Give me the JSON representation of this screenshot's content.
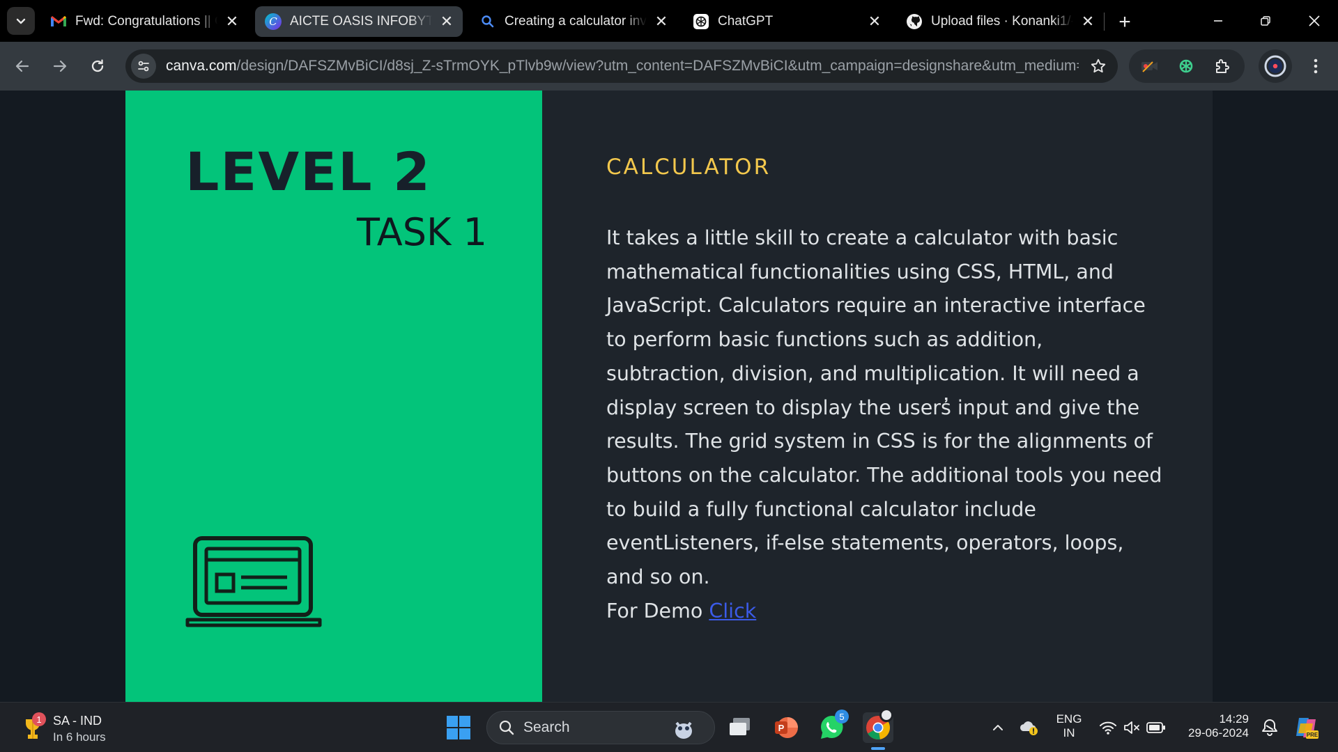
{
  "browser": {
    "tabs": [
      {
        "title": "Fwd: Congratulations || O",
        "favicon": "gmail-icon"
      },
      {
        "title": "AICTE OASIS INFOBYTE S",
        "favicon": "canva-icon",
        "active": true
      },
      {
        "title": "Creating a calculator invo",
        "favicon": "search-icon"
      },
      {
        "title": "ChatGPT",
        "favicon": "chatgpt-icon"
      },
      {
        "title": "Upload files · Konanki1/-",
        "favicon": "github-icon"
      }
    ],
    "url_host": "canva.com",
    "url_path": "/design/DAFSZMvBiCI/d8sj_Z-sTrmOYK_pTlvb9w/view?utm_content=DAFSZMvBiCI&utm_campaign=designshare&utm_medium=..."
  },
  "slide": {
    "level": "LEVEL 2",
    "task": "TASK 1",
    "heading": "CALCULATOR",
    "description": "It takes a little skill to create a calculator with basic mathematical functionalities using CSS, HTML, and JavaScript. Calculators require an interactive interface to perform basic functions such as addition, subtraction, division, and multiplication. It will need a  display screen to display the users̓ input and give the results. The grid system in CSS is for the alignments of buttons on the calculator. The additional tools you need to build a fully functional calculator include eventListeners, if-else statements, operators, loops, and so on.",
    "demo_prefix": "For Demo ",
    "demo_link": "Click",
    "colors": {
      "left_panel": "#03c47a",
      "right_panel": "#1e242b",
      "heading": "#f3c84d",
      "link": "#3b5be8"
    }
  },
  "taskbar": {
    "weather_title": "SA - IND",
    "weather_sub": "In 6 hours",
    "weather_badge": "1",
    "search_label": "Search",
    "whatsapp_badge": "5",
    "lang_top": "ENG",
    "lang_bottom": "IN",
    "time": "14:29",
    "date": "29-06-2024"
  }
}
